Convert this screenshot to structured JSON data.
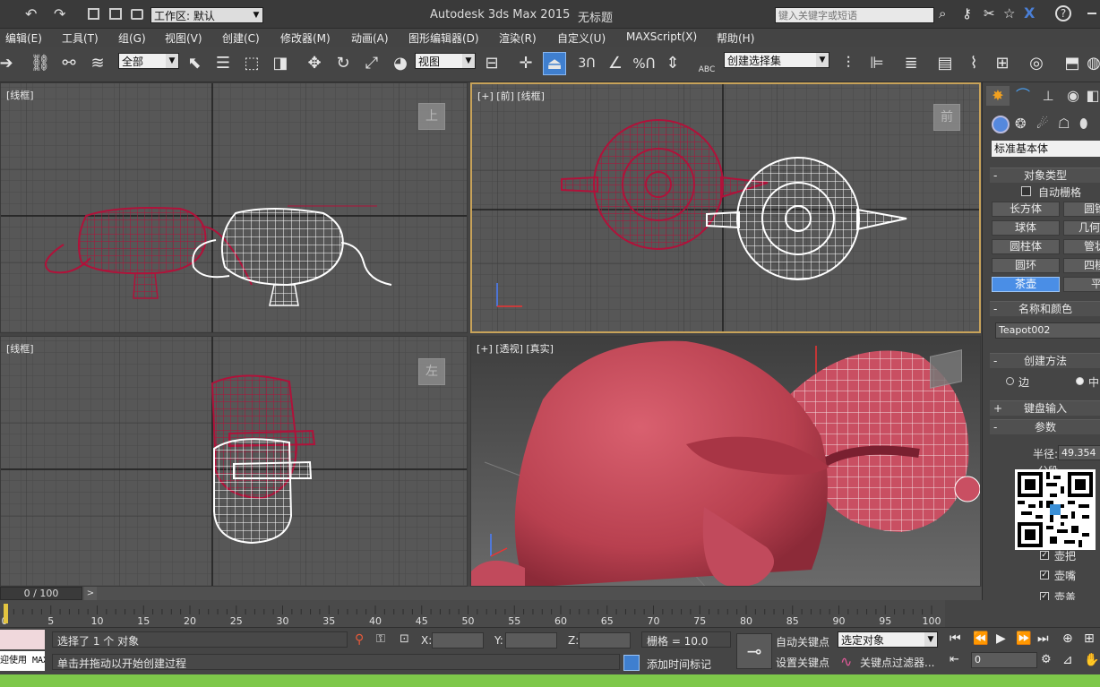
{
  "title": {
    "app": "Autodesk 3ds Max  2015",
    "document": "无标题",
    "workspace": "工作区: 默认",
    "search_placeholder": "键入关键字或短语"
  },
  "menu": [
    "编辑(E)",
    "工具(T)",
    "组(G)",
    "视图(V)",
    "创建(C)",
    "修改器(M)",
    "动画(A)",
    "图形编辑器(D)",
    "渲染(R)",
    "自定义(U)",
    "MAXScript(X)",
    "帮助(H)"
  ],
  "toolbar": {
    "selection_filter": "全部",
    "ref_coord": "视图",
    "named_selection": "创建选择集",
    "snap_3": "3",
    "percent": "%",
    "abc": "ABC"
  },
  "viewports": {
    "top": {
      "label": "[线框]",
      "cube": "上"
    },
    "front": {
      "label": "[+] [前] [线框]",
      "cube": "前"
    },
    "left": {
      "label": "[线框]",
      "cube": "左"
    },
    "persp": {
      "label": "[+] [透视] [真实]"
    }
  },
  "colors": {
    "selected": "#b0123a",
    "wire": "#ffffff",
    "accent": "#4a8ee6",
    "shaded": "#c94f62"
  },
  "command_panel": {
    "category": "标准基本体",
    "rollouts": {
      "object_type": "对象类型",
      "autogrid": "自动栅格",
      "name_color": "名称和颜色",
      "creation_method": "创建方法",
      "keyboard_entry": "键盘输入",
      "parameters": "参数"
    },
    "object_buttons": [
      "长方体",
      "圆锥",
      "球体",
      "几何",
      "圆柱体",
      "管状",
      "圆环",
      "四棱",
      "茶壶",
      "平面"
    ],
    "object_name": "Teapot002",
    "creation_options": [
      "边",
      "中"
    ],
    "radius_label": "半径:",
    "radius_value": "49.354",
    "segments_label": "分段",
    "parts": [
      "壶把",
      "壶嘴",
      "壶盖"
    ]
  },
  "timeline": {
    "frame_display": "0 / 100",
    "ticks": [
      "0",
      "5",
      "10",
      "15",
      "20",
      "25",
      "30",
      "35",
      "40",
      "45",
      "50",
      "55",
      "60",
      "65",
      "70",
      "75",
      "80",
      "85",
      "90",
      "95",
      "100"
    ]
  },
  "status": {
    "maxscript": "欢迎使用 MAXSc",
    "selection": "选择了 1 个 对象",
    "prompt": "单击并拖动以开始创建过程",
    "x_label": "X:",
    "y_label": "Y:",
    "z_label": "Z:",
    "grid": "栅格 = 10.0",
    "add_time_tag": "添加时间标记",
    "auto_key": "自动关键点",
    "set_key": "设置关键点",
    "key_mode": "选定对象",
    "key_filters": "关键点过滤器...",
    "frame_field": "0"
  }
}
